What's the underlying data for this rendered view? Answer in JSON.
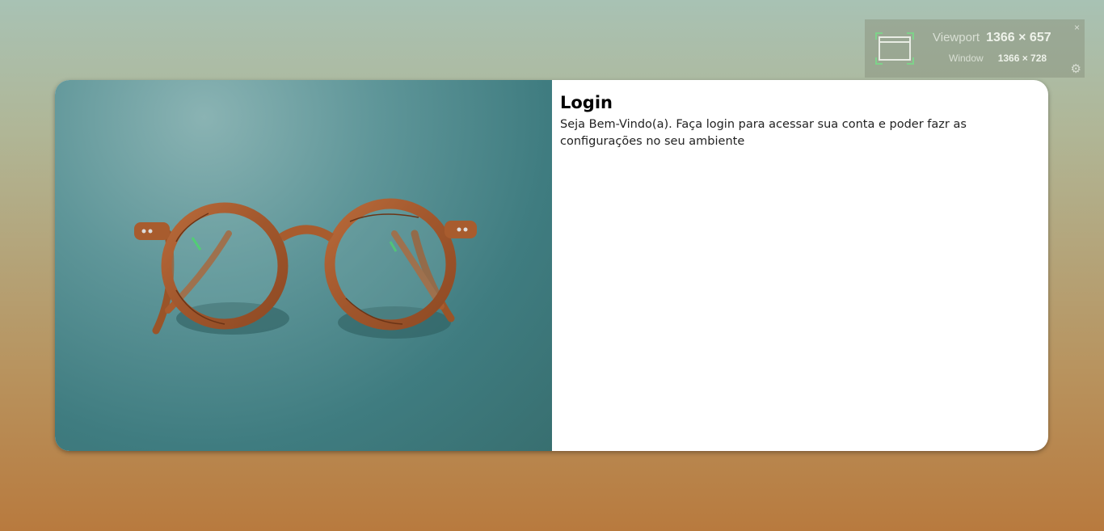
{
  "login": {
    "title": "Login",
    "subtitle": "Seja Bem-Vindo(a). Faça login para acessar sua conta e poder fazr as configurações no seu ambiente"
  },
  "viewport_widget": {
    "viewport_label": "Viewport",
    "viewport_value": "1366 × 657",
    "window_label": "Window",
    "window_value": "1366 × 728",
    "close_glyph": "×",
    "settings_glyph": "⚙"
  }
}
